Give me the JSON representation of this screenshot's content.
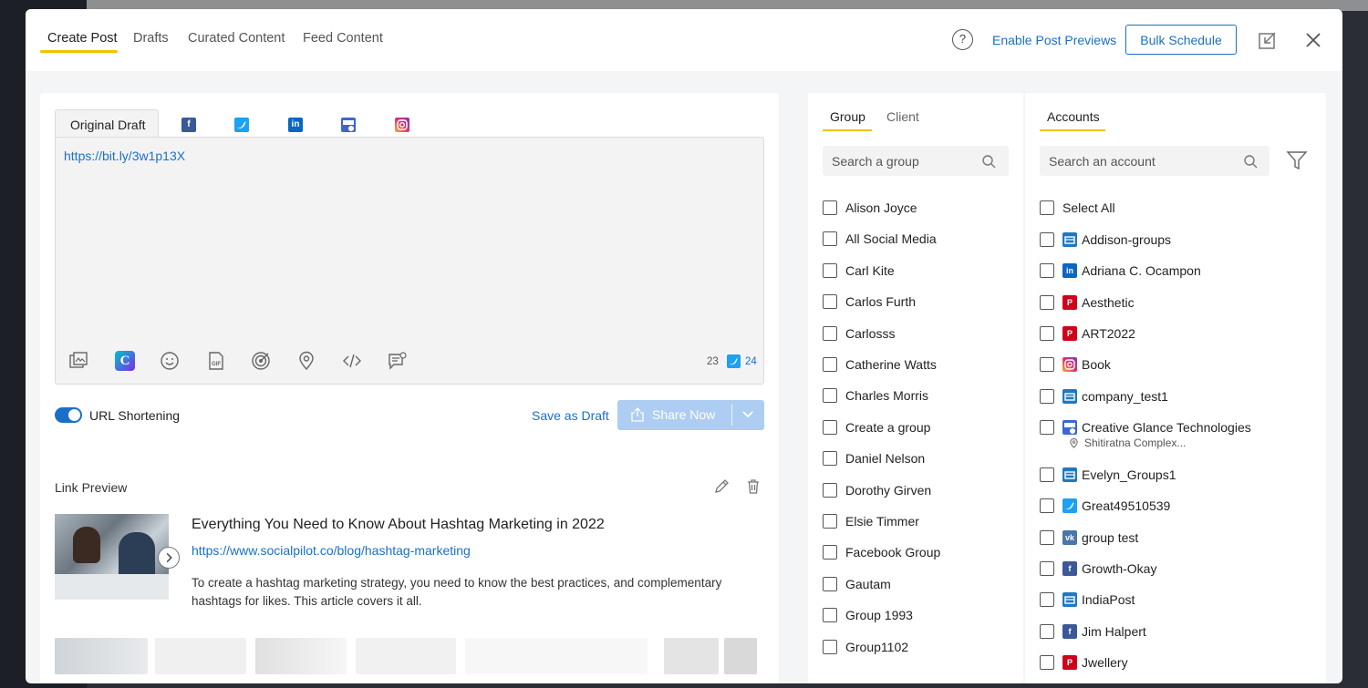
{
  "header": {
    "tabs": [
      {
        "label": "Create Post"
      },
      {
        "label": "Drafts"
      },
      {
        "label": "Curated Content"
      },
      {
        "label": "Feed Content"
      }
    ],
    "help_label": "?",
    "enable_previews": "Enable Post Previews",
    "bulk_schedule": "Bulk Schedule"
  },
  "composer": {
    "draft_tab": "Original Draft",
    "networks": [
      "facebook-icon",
      "twitter-icon",
      "linkedin-icon",
      "google-business-icon",
      "instagram-icon"
    ],
    "text": "https://bit.ly/3w1p13X",
    "char_count": "23",
    "twitter_count": "24",
    "url_shortening_label": "URL Shortening",
    "url_shortening_on": true,
    "save_draft": "Save as Draft",
    "share_now": "Share Now"
  },
  "link_preview": {
    "title": "Link Preview",
    "headline": "Everything You Need to Know About Hashtag Marketing in 2022",
    "url": "https://www.socialpilot.co/blog/hashtag-marketing",
    "description": "To create a hashtag marketing strategy, you need to know the best practices, and complementary hashtags for likes. This article covers it all."
  },
  "groups": {
    "tabs": [
      {
        "label": "Group"
      },
      {
        "label": "Client"
      }
    ],
    "search_placeholder": "Search a group",
    "items": [
      "Alison Joyce",
      "All Social Media",
      "Carl Kite",
      "Carlos Furth",
      "Carlosss",
      "Catherine Watts",
      "Charles Morris",
      "Create a group",
      "Daniel Nelson",
      "Dorothy Girven",
      "Elsie Timmer",
      "Facebook Group",
      "Gautam",
      "Group 1993",
      "Group1102"
    ]
  },
  "accounts": {
    "tab": "Accounts",
    "search_placeholder": "Search an account",
    "select_all": "Select All",
    "items": [
      {
        "label": "Addison-groups",
        "icon": "group-icon",
        "color": "#1f78c1"
      },
      {
        "label": "Adriana C. Ocampon",
        "icon": "linkedin-icon",
        "color": "#0a66c2"
      },
      {
        "label": "Aesthetic",
        "icon": "pinterest-icon",
        "color": "#d0021b"
      },
      {
        "label": "ART2022",
        "icon": "pinterest-icon",
        "color": "#d0021b"
      },
      {
        "label": "Book",
        "icon": "instagram-icon",
        "color": "#e1306c"
      },
      {
        "label": "company_test1",
        "icon": "group-icon",
        "color": "#1f78c1"
      },
      {
        "label": "Creative Glance Technologies",
        "icon": "google-business-icon",
        "color": "#3b66d6",
        "sub": "Shitiratna Complex..."
      },
      {
        "label": "Evelyn_Groups1",
        "icon": "group-icon",
        "color": "#1f78c1"
      },
      {
        "label": "Great49510539",
        "icon": "twitter-icon",
        "color": "#1da1f2"
      },
      {
        "label": "group test",
        "icon": "vk-icon",
        "color": "#4a76a8"
      },
      {
        "label": "Growth-Okay",
        "icon": "facebook-icon",
        "color": "#3b5998"
      },
      {
        "label": "IndiaPost",
        "icon": "group-icon",
        "color": "#1f78c1"
      },
      {
        "label": "Jim Halpert",
        "icon": "facebook-icon",
        "color": "#3b5998"
      },
      {
        "label": "Jwellery",
        "icon": "pinterest-icon",
        "color": "#d0021b"
      }
    ]
  }
}
